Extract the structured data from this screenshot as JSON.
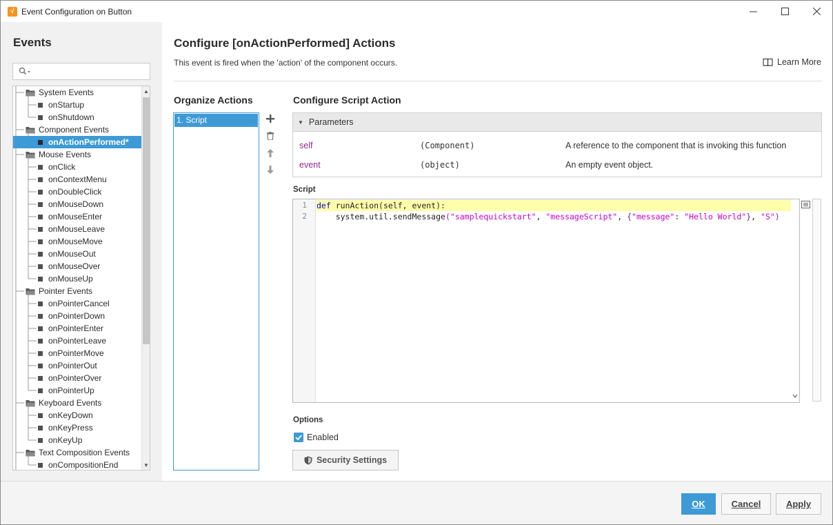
{
  "window": {
    "title": "Event Configuration on Button",
    "app_icon": "ignition-icon",
    "controls": [
      "minimize-icon",
      "maximize-icon",
      "close-icon"
    ]
  },
  "events_panel": {
    "title": "Events",
    "search": {
      "value": "",
      "placeholder": ""
    },
    "tree": [
      {
        "label": "System Events",
        "type": "folder",
        "level": 0
      },
      {
        "label": "onStartup",
        "type": "leaf",
        "level": 1
      },
      {
        "label": "onShutdown",
        "type": "leaf",
        "level": 1
      },
      {
        "label": "Component Events",
        "type": "folder",
        "level": 0
      },
      {
        "label": "onActionPerformed*",
        "type": "leaf",
        "level": 1,
        "selected": true
      },
      {
        "label": "Mouse Events",
        "type": "folder",
        "level": 0
      },
      {
        "label": "onClick",
        "type": "leaf",
        "level": 1
      },
      {
        "label": "onContextMenu",
        "type": "leaf",
        "level": 1
      },
      {
        "label": "onDoubleClick",
        "type": "leaf",
        "level": 1
      },
      {
        "label": "onMouseDown",
        "type": "leaf",
        "level": 1
      },
      {
        "label": "onMouseEnter",
        "type": "leaf",
        "level": 1
      },
      {
        "label": "onMouseLeave",
        "type": "leaf",
        "level": 1
      },
      {
        "label": "onMouseMove",
        "type": "leaf",
        "level": 1
      },
      {
        "label": "onMouseOut",
        "type": "leaf",
        "level": 1
      },
      {
        "label": "onMouseOver",
        "type": "leaf",
        "level": 1
      },
      {
        "label": "onMouseUp",
        "type": "leaf",
        "level": 1
      },
      {
        "label": "Pointer Events",
        "type": "folder",
        "level": 0
      },
      {
        "label": "onPointerCancel",
        "type": "leaf",
        "level": 1
      },
      {
        "label": "onPointerDown",
        "type": "leaf",
        "level": 1
      },
      {
        "label": "onPointerEnter",
        "type": "leaf",
        "level": 1
      },
      {
        "label": "onPointerLeave",
        "type": "leaf",
        "level": 1
      },
      {
        "label": "onPointerMove",
        "type": "leaf",
        "level": 1
      },
      {
        "label": "onPointerOut",
        "type": "leaf",
        "level": 1
      },
      {
        "label": "onPointerOver",
        "type": "leaf",
        "level": 1
      },
      {
        "label": "onPointerUp",
        "type": "leaf",
        "level": 1
      },
      {
        "label": "Keyboard Events",
        "type": "folder",
        "level": 0
      },
      {
        "label": "onKeyDown",
        "type": "leaf",
        "level": 1
      },
      {
        "label": "onKeyPress",
        "type": "leaf",
        "level": 1
      },
      {
        "label": "onKeyUp",
        "type": "leaf",
        "level": 1
      },
      {
        "label": "Text Composition Events",
        "type": "folder",
        "level": 0
      },
      {
        "label": "onCompositionEnd",
        "type": "leaf",
        "level": 1
      }
    ]
  },
  "main": {
    "title": "Configure [onActionPerformed] Actions",
    "description": "This event is fired when the 'action' of the component occurs.",
    "learn_more": "Learn More",
    "organize": {
      "title": "Organize Actions",
      "items": [
        "1. Script"
      ],
      "tools": [
        "add-icon",
        "delete-icon",
        "move-up-icon",
        "move-down-icon"
      ]
    },
    "configure": {
      "title": "Configure Script Action",
      "parameters_label": "Parameters",
      "parameters": [
        {
          "name": "self",
          "type": "(Component)",
          "description": "A reference to the component that is invoking this function"
        },
        {
          "name": "event",
          "type": "(object)",
          "description": "An empty event object."
        }
      ],
      "script_label": "Script",
      "script_lines": [
        {
          "number": "1"
        },
        {
          "number": "2"
        }
      ],
      "code": {
        "line1": {
          "kw": "def",
          "fn": " runAction",
          "args": "(self, event):"
        },
        "line2": {
          "indent": "    ",
          "call": "system.util.sendMessage",
          "open": "(",
          "s1": "\"samplequickstart\"",
          "comma1": ", ",
          "s2": "\"messageScript\"",
          "comma2": ", ",
          "brace_open": "{",
          "s3": "\"message\"",
          "colon": ": ",
          "s4": "\"Hello World\"",
          "brace_close": "}",
          "comma3": ", ",
          "s5": "\"S\"",
          "close": ")"
        }
      }
    },
    "options": {
      "label": "Options",
      "enabled_label": "Enabled",
      "enabled": true,
      "security_button": "Security Settings"
    }
  },
  "footer": {
    "ok": "OK",
    "cancel": "Cancel",
    "apply": "Apply"
  },
  "colors": {
    "accent": "#3d9ad6",
    "param_name": "#8e2a91",
    "keyword": "#0000c8",
    "string": "#c600c6",
    "line_highlight": "#ffffaa"
  }
}
